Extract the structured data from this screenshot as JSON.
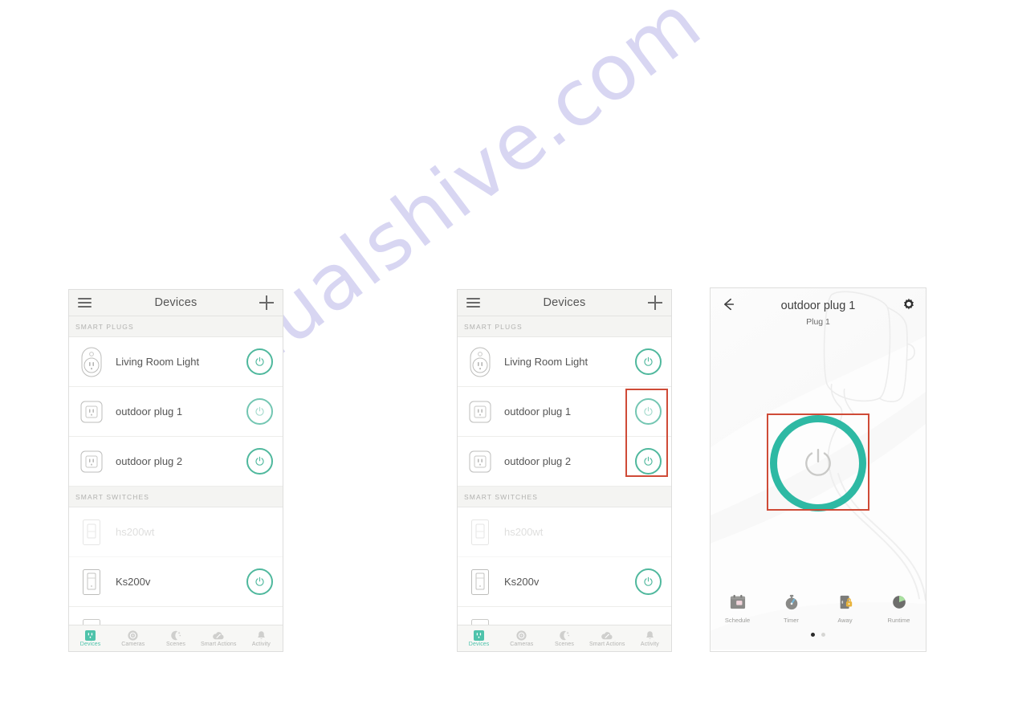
{
  "watermark": {
    "text": "manualshive.com",
    "color": "#b9b6e8"
  },
  "theme": {
    "accent": "#4fb89d",
    "accent_strong": "#2eb9a4",
    "highlight": "#cf4b37"
  },
  "screens": [
    {
      "id": "devices-list-plain",
      "header": {
        "title": "Devices",
        "menu_icon": "hamburger-icon",
        "add_icon": "plus-icon"
      },
      "sections": [
        {
          "label": "SMART PLUGS",
          "rows": [
            {
              "name": "Living Room Light",
              "icon": "smart-plug-oval-icon",
              "toggle": "power-icon",
              "toggle_state": "on",
              "dim": false
            },
            {
              "name": "outdoor plug 1",
              "icon": "smart-plug-square-icon",
              "toggle": "power-icon",
              "toggle_state": "off",
              "dim": false
            },
            {
              "name": "outdoor plug 2",
              "icon": "smart-plug-square-icon",
              "toggle": "power-icon",
              "toggle_state": "on",
              "dim": false
            }
          ]
        },
        {
          "label": "SMART SWITCHES",
          "rows": [
            {
              "name": "hs200wt",
              "icon": "wall-switch-icon",
              "toggle": null,
              "toggle_state": "unavailable",
              "dim": true
            },
            {
              "name": "Ks200v",
              "icon": "wall-switch-icon",
              "toggle": "power-icon",
              "toggle_state": "on",
              "dim": false
            }
          ]
        }
      ],
      "tabs": [
        {
          "label": "Devices",
          "icon": "devices-icon",
          "active": true
        },
        {
          "label": "Cameras",
          "icon": "camera-icon",
          "active": false
        },
        {
          "label": "Scenes",
          "icon": "moon-stars-icon",
          "active": false
        },
        {
          "label": "Smart Actions",
          "icon": "magic-cloud-icon",
          "active": false
        },
        {
          "label": "Activity",
          "icon": "bell-icon",
          "active": false
        }
      ]
    },
    {
      "id": "devices-list-highlighted",
      "header": {
        "title": "Devices",
        "menu_icon": "hamburger-icon",
        "add_icon": "plus-icon"
      },
      "sections": [
        {
          "label": "SMART PLUGS",
          "rows": [
            {
              "name": "Living Room Light",
              "icon": "smart-plug-oval-icon",
              "toggle": "power-icon",
              "toggle_state": "on",
              "dim": false
            },
            {
              "name": "outdoor plug 1",
              "icon": "smart-plug-square-icon",
              "toggle": "power-icon",
              "toggle_state": "off",
              "dim": false
            },
            {
              "name": "outdoor plug 2",
              "icon": "smart-plug-square-icon",
              "toggle": "power-icon",
              "toggle_state": "on",
              "dim": false
            }
          ]
        },
        {
          "label": "SMART SWITCHES",
          "rows": [
            {
              "name": "hs200wt",
              "icon": "wall-switch-icon",
              "toggle": null,
              "toggle_state": "unavailable",
              "dim": true
            },
            {
              "name": "Ks200v",
              "icon": "wall-switch-icon",
              "toggle": "power-icon",
              "toggle_state": "on",
              "dim": false
            }
          ]
        }
      ],
      "tabs": [
        {
          "label": "Devices",
          "icon": "devices-icon",
          "active": true
        },
        {
          "label": "Cameras",
          "icon": "camera-icon",
          "active": false
        },
        {
          "label": "Scenes",
          "icon": "moon-stars-icon",
          "active": false
        },
        {
          "label": "Smart Actions",
          "icon": "magic-cloud-icon",
          "active": false
        },
        {
          "label": "Activity",
          "icon": "bell-icon",
          "active": false
        }
      ],
      "highlight": {
        "target": "power-toggles-outdoor-plugs"
      }
    },
    {
      "id": "device-detail",
      "header": {
        "title": "outdoor plug 1",
        "subtitle": "Plug 1",
        "back_icon": "back-arrow-icon",
        "settings_icon": "gear-icon"
      },
      "big_toggle": {
        "icon": "power-icon",
        "state": "on"
      },
      "tools": [
        {
          "label": "Schedule",
          "icon": "calendar-icon"
        },
        {
          "label": "Timer",
          "icon": "stopwatch-icon"
        },
        {
          "label": "Away",
          "icon": "door-lock-icon"
        },
        {
          "label": "Runtime",
          "icon": "pie-chart-icon"
        }
      ],
      "pager": {
        "pages": 2,
        "current": 1
      },
      "highlight": {
        "target": "big-power-toggle"
      }
    }
  ]
}
